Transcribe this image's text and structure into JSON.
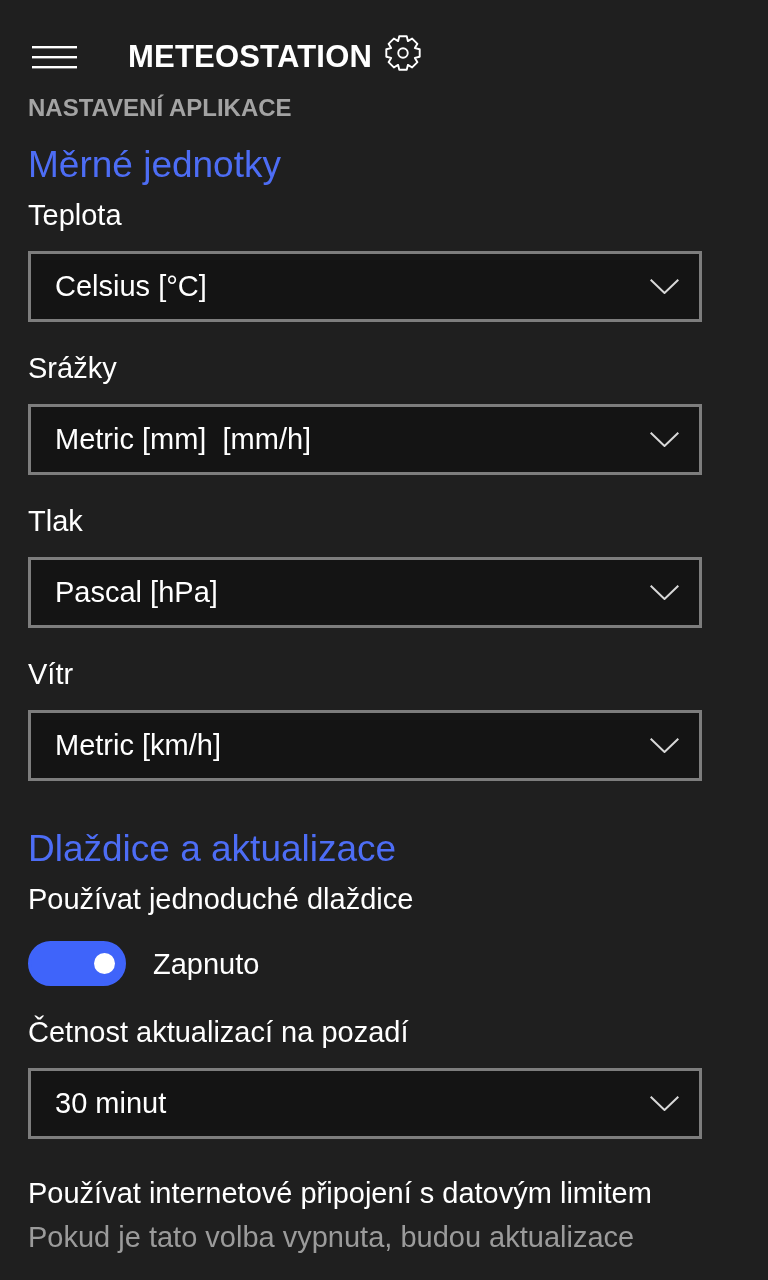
{
  "header": {
    "title": "METEOSTATION"
  },
  "page_title": "NASTAVENÍ APLIKACE",
  "sections": [
    {
      "heading": "Měrné jednotky",
      "settings": [
        {
          "kind": "dropdown",
          "label": "Teplota",
          "value": "Celsius [°C]"
        },
        {
          "kind": "dropdown",
          "label": "Srážky",
          "value": "Metric [mm]  [mm/h]"
        },
        {
          "kind": "dropdown",
          "label": "Tlak",
          "value": "Pascal [hPa]"
        },
        {
          "kind": "dropdown",
          "label": "Vítr",
          "value": "Metric [km/h]"
        }
      ]
    },
    {
      "heading": "Dlaždice a aktualizace",
      "settings": [
        {
          "kind": "toggle",
          "label": "Používat jednoduché dlaždice",
          "on": true,
          "state_text": "Zapnuto"
        },
        {
          "kind": "dropdown",
          "label": "Četnost aktualizací na pozadí",
          "value": "30 minut"
        },
        {
          "kind": "text",
          "label": "Používat internetové připojení s datovým limitem",
          "description": "Pokud je tato volba vypnuta, budou aktualizace"
        }
      ]
    }
  ]
}
